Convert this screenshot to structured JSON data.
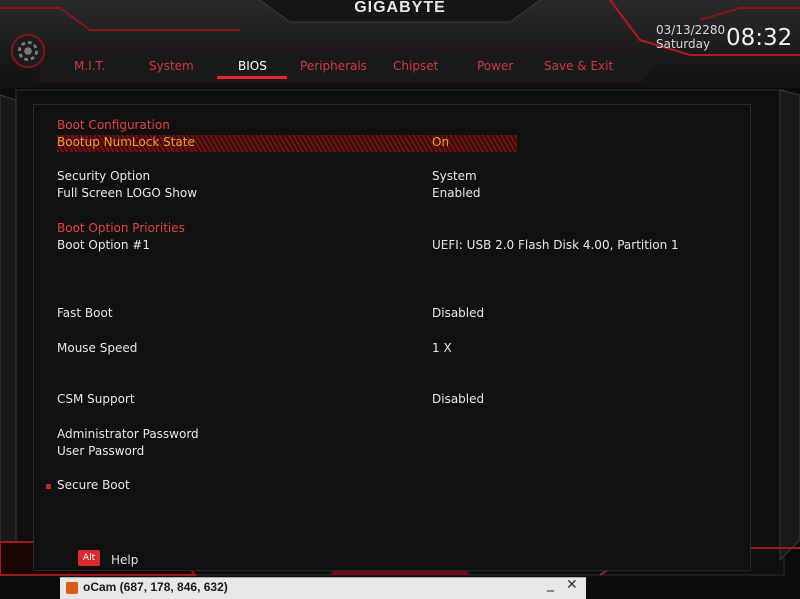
{
  "header": {
    "brand": "GIGABYTE",
    "date": "03/13/2280",
    "day": "Saturday",
    "time": "08:32"
  },
  "tabs": [
    {
      "label": "M.I.T.",
      "active": false
    },
    {
      "label": "System",
      "active": false
    },
    {
      "label": "BIOS",
      "active": true
    },
    {
      "label": "Peripherals",
      "active": false
    },
    {
      "label": "Chipset",
      "active": false
    },
    {
      "label": "Power",
      "active": false
    },
    {
      "label": "Save & Exit",
      "active": false
    }
  ],
  "sections": {
    "boot_configuration": "Boot Configuration",
    "boot_option_priorities": "Boot Option Priorities"
  },
  "settings": {
    "numlock": {
      "label": "Bootup NumLock State",
      "value": "On"
    },
    "security_option": {
      "label": "Security Option",
      "value": "System"
    },
    "logo_show": {
      "label": "Full Screen LOGO Show",
      "value": "Enabled"
    },
    "boot_option_1": {
      "label": "Boot Option #1",
      "value": "UEFI: USB 2.0 Flash Disk 4.00, Partition 1"
    },
    "fast_boot": {
      "label": "Fast Boot",
      "value": "Disabled"
    },
    "mouse_speed": {
      "label": "Mouse Speed",
      "value": "1 X"
    },
    "csm_support": {
      "label": "CSM Support",
      "value": "Disabled"
    },
    "admin_password": {
      "label": "Administrator Password"
    },
    "user_password": {
      "label": "User Password"
    },
    "secure_boot": {
      "label": "Secure Boot"
    }
  },
  "footer": {
    "help_key": "Alt",
    "help_label": "Help"
  },
  "ocam": {
    "title": "oCam (687, 178, 846, 632)",
    "minimize": "_",
    "close": "✕"
  },
  "colors": {
    "accent": "#e0282e",
    "section_text": "#e0463f",
    "selected_text": "#f29a3a",
    "background": "#0d0d0d"
  }
}
